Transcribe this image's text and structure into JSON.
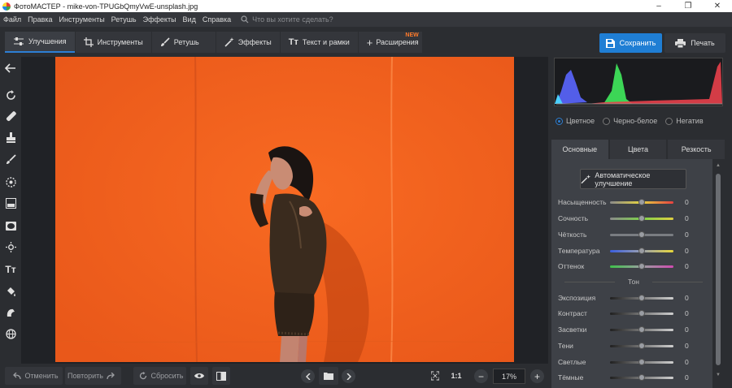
{
  "window": {
    "title": "ФотоМАСТЕР - mike-von-TPUGbQmyVwE-unsplash.jpg",
    "controls": [
      "–",
      "❐",
      "✕"
    ]
  },
  "menu": {
    "items": [
      "Файл",
      "Правка",
      "Инструменты",
      "Ретушь",
      "Эффекты",
      "Вид",
      "Справка"
    ],
    "search_placeholder": "Что вы хотите сделать?"
  },
  "toolbar": {
    "tabs": [
      {
        "label": "Улучшения",
        "icon": "sliders-icon",
        "active": true
      },
      {
        "label": "Инструменты",
        "icon": "crop-icon",
        "active": false
      },
      {
        "label": "Ретушь",
        "icon": "brush-icon",
        "active": false
      },
      {
        "label": "Эффекты",
        "icon": "magic-wand-icon",
        "active": false
      },
      {
        "label": "Текст и рамки",
        "icon": "text-icon",
        "active": false
      },
      {
        "label": "Расширения",
        "icon": "plus-icon",
        "active": false,
        "badge": "NEW"
      }
    ],
    "save_label": "Сохранить",
    "print_label": "Печать",
    "accent": "#1f7ed4"
  },
  "left_tools": [
    "back-arrow-icon",
    "rotate-icon",
    "healing-patch-icon",
    "stamp-icon",
    "brush-icon",
    "radial-filter-icon",
    "gradient-filter-icon",
    "vignette-icon",
    "light-icon",
    "text-tool-icon",
    "fill-bucket-icon",
    "color-replace-icon",
    "globe-icon"
  ],
  "panel": {
    "modes": [
      {
        "label": "Цветное",
        "selected": true
      },
      {
        "label": "Черно-белое",
        "selected": false
      },
      {
        "label": "Негатив",
        "selected": false
      }
    ],
    "tabs": [
      {
        "label": "Основные",
        "active": true
      },
      {
        "label": "Цвета",
        "active": false
      },
      {
        "label": "Резкость",
        "active": false
      }
    ],
    "auto_label": "Автоматическое улучшение",
    "sliders": [
      {
        "label": "Насыщенность",
        "value": "0"
      },
      {
        "label": "Сочность",
        "value": "0"
      },
      {
        "label": "Чёткость",
        "value": "0"
      },
      {
        "label": "Температура",
        "value": "0"
      },
      {
        "label": "Оттенок",
        "value": "0"
      }
    ],
    "tone_label": "Тон",
    "tone_sliders": [
      {
        "label": "Экспозиция",
        "value": "0"
      },
      {
        "label": "Контраст",
        "value": "0"
      },
      {
        "label": "Засветки",
        "value": "0"
      },
      {
        "label": "Тени",
        "value": "0"
      },
      {
        "label": "Светлые",
        "value": "0"
      },
      {
        "label": "Тёмные",
        "value": "0"
      }
    ]
  },
  "bottom": {
    "undo_label": "Отменить",
    "redo_label": "Повторить",
    "reset_label": "Сбросить",
    "ratio_label": "1:1",
    "zoom": "17%"
  }
}
